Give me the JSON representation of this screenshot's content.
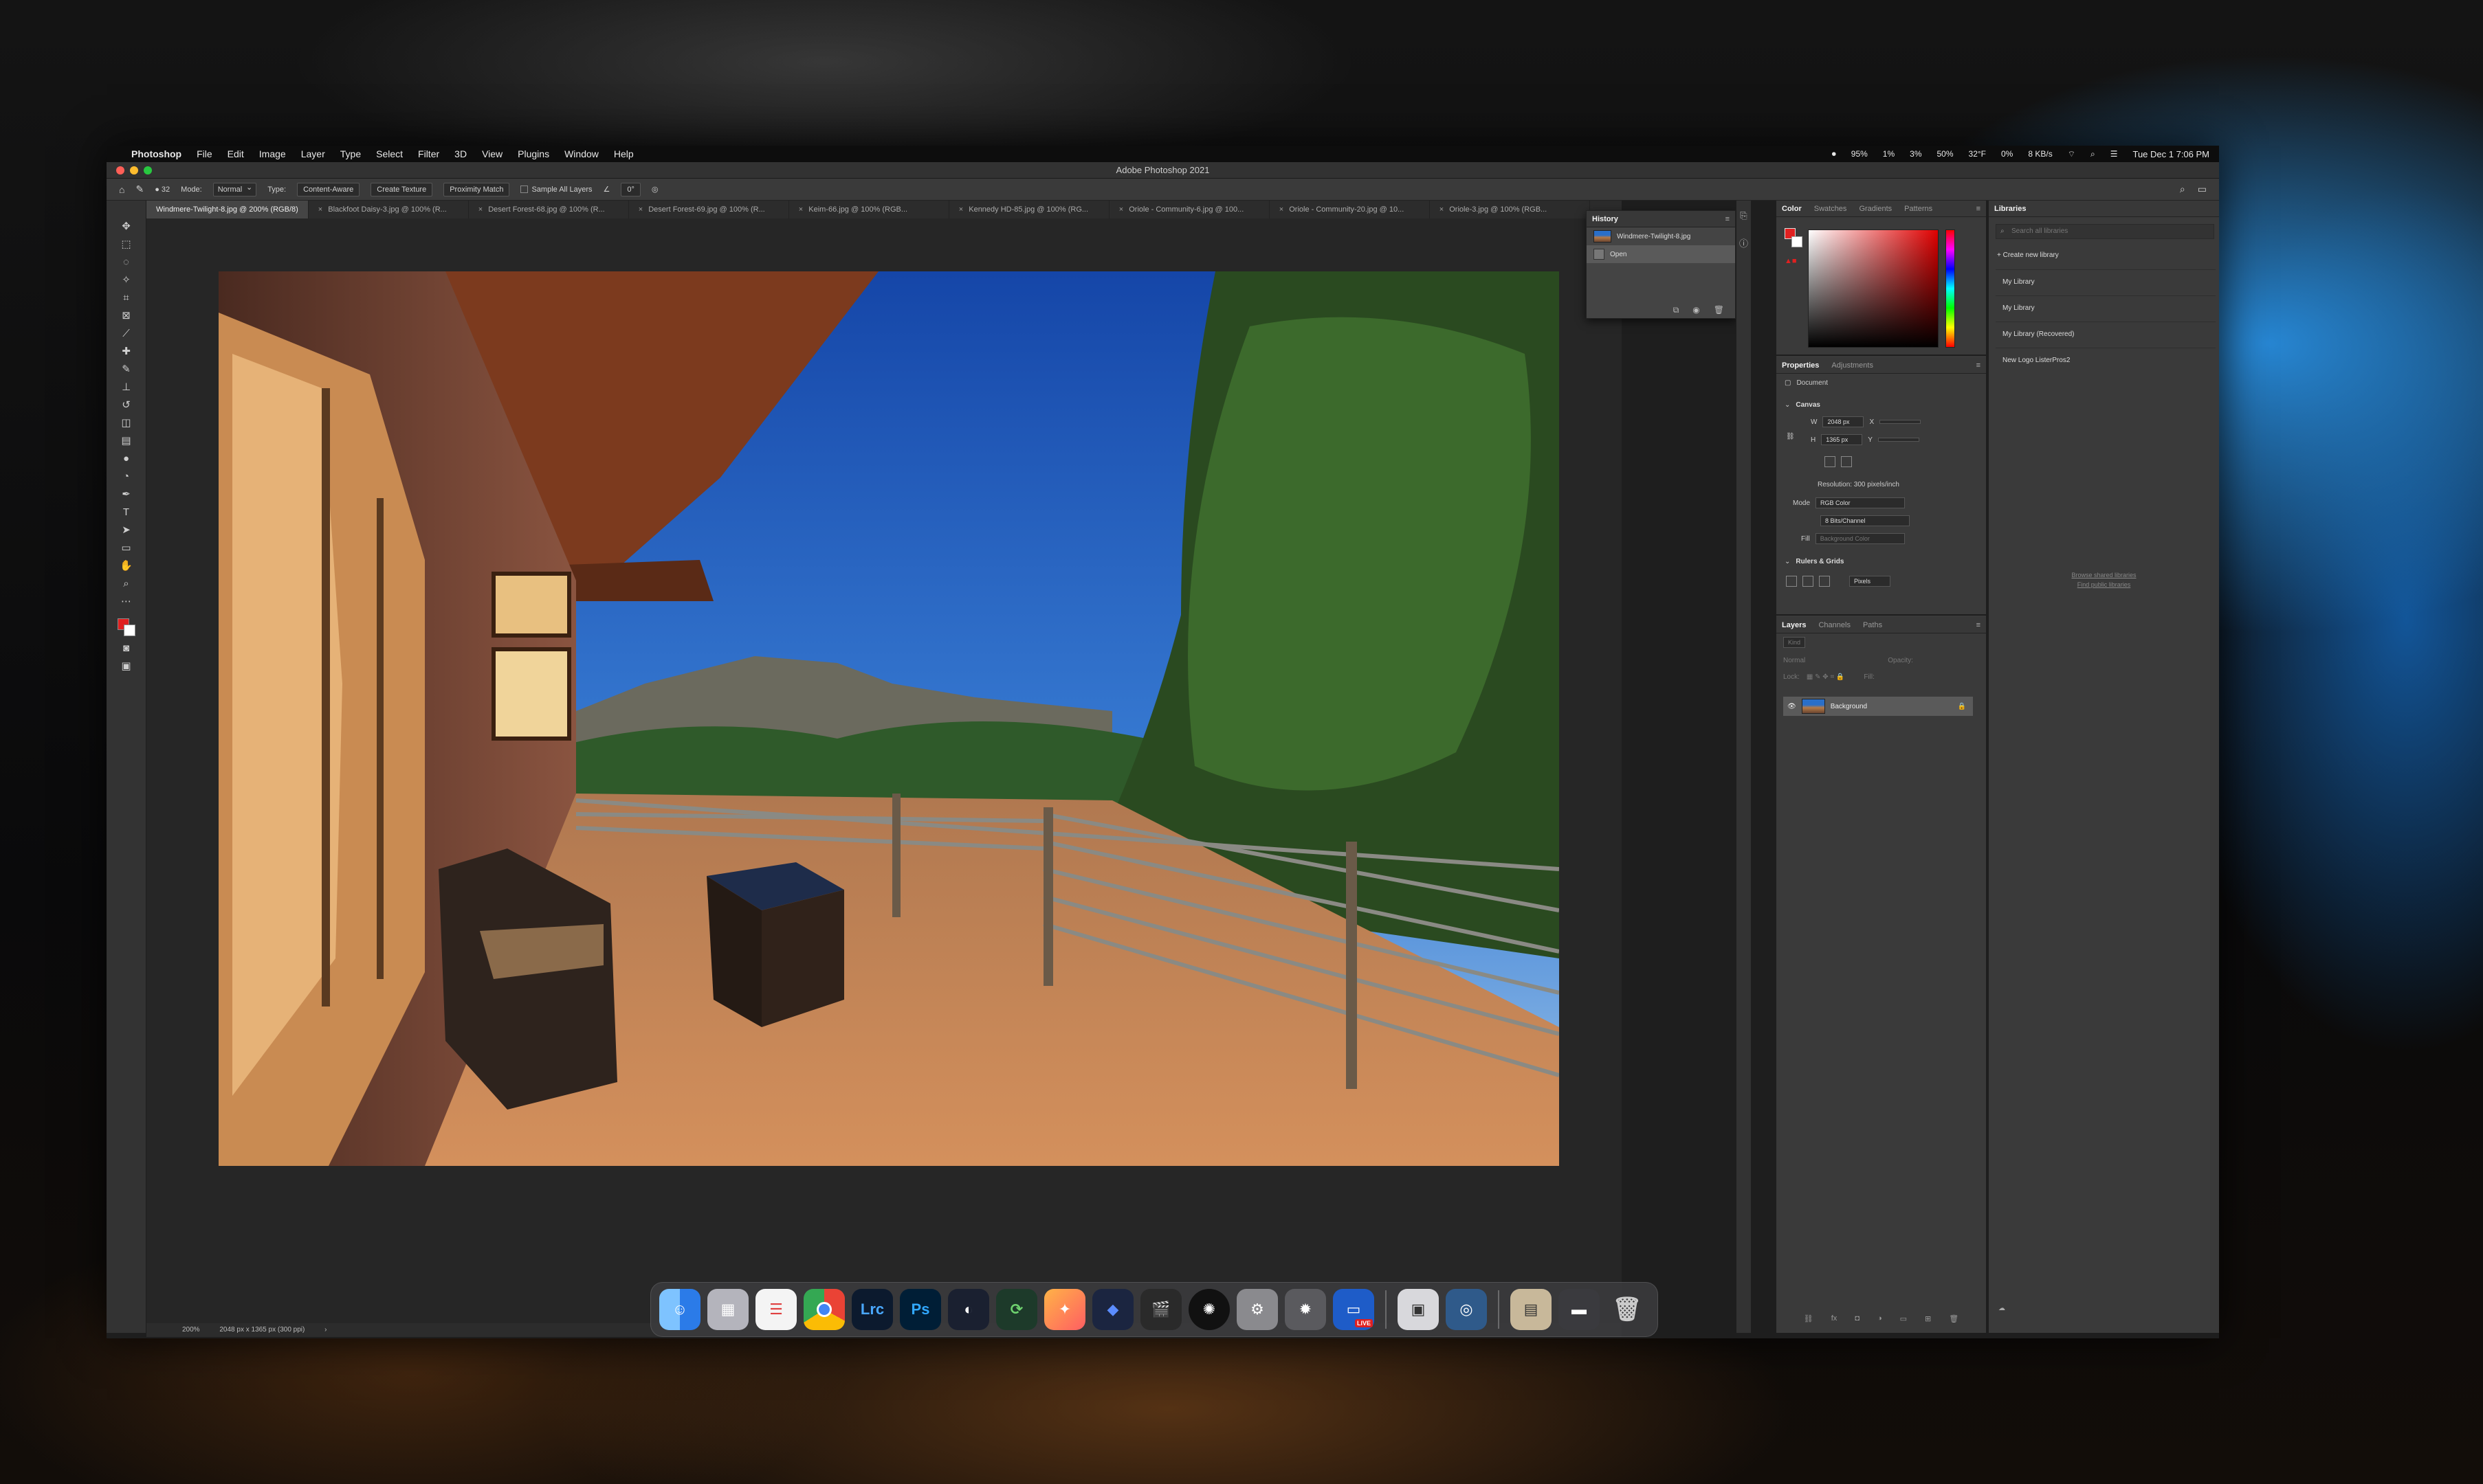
{
  "menubar": {
    "app_name": "Photoshop",
    "items": [
      "File",
      "Edit",
      "Image",
      "Layer",
      "Type",
      "Select",
      "Filter",
      "3D",
      "View",
      "Plugins",
      "Window",
      "Help"
    ],
    "status": [
      "95%",
      "1%",
      "3%",
      "50%",
      "32°F",
      "0%",
      "8 KB/s"
    ],
    "clock": "Tue Dec 1  7:06 PM"
  },
  "titlebar": {
    "title": "Adobe Photoshop 2021"
  },
  "options": {
    "brush_size": "32",
    "mode_label": "Mode:",
    "mode_value": "Normal",
    "type_label": "Type:",
    "type_buttons": [
      "Content-Aware",
      "Create Texture",
      "Proximity Match"
    ],
    "sample_all_layers": "Sample All Layers",
    "angle_value": "0°"
  },
  "tabs": [
    "Windmere-Twilight-8.jpg @ 200% (RGB/8)",
    "Blackfoot Daisy-3.jpg @ 100% (R...",
    "Desert Forest-68.jpg @ 100% (R...",
    "Desert Forest-69.jpg @ 100% (R...",
    "Keim-66.jpg @ 100% (RGB...",
    "Kennedy HD-85.jpg @ 100% (RG...",
    "Oriole - Community-6.jpg @ 100...",
    "Oriole - Community-20.jpg @ 10...",
    "Oriole-3.jpg @ 100% (RGB..."
  ],
  "statusbar": {
    "zoom": "200%",
    "doc_info": "2048 px x 1365 px (300 ppi)"
  },
  "history": {
    "tab": "History",
    "snapshot": "Windmere-Twilight-8.jpg",
    "states": [
      "Open"
    ]
  },
  "color_panel": {
    "tabs": [
      "Color",
      "Swatches",
      "Gradients",
      "Patterns"
    ]
  },
  "properties": {
    "tabs": [
      "Properties",
      "Adjustments"
    ],
    "kind": "Document",
    "canvas_header": "Canvas",
    "w_label": "W",
    "w_value": "2048 px",
    "h_label": "H",
    "h_value": "1365 px",
    "x_label": "X",
    "y_label": "Y",
    "resolution": "Resolution: 300 pixels/inch",
    "mode_label": "Mode",
    "mode_value": "RGB Color",
    "bits_value": "8 Bits/Channel",
    "fill_label": "Fill",
    "fill_value": "Background Color",
    "rulers_header": "Rulers & Grids",
    "units_value": "Pixels"
  },
  "layers": {
    "tabs": [
      "Layers",
      "Channels",
      "Paths"
    ],
    "kind_placeholder": "Kind",
    "blend": "Normal",
    "opacity_label": "Opacity:",
    "lock_label": "Lock:",
    "fill_label": "Fill:",
    "items": [
      "Background"
    ]
  },
  "libraries": {
    "tab": "Libraries",
    "search_placeholder": "Search all libraries",
    "create": "Create new library",
    "items": [
      "My Library",
      "My Library",
      "My Library (Recovered)",
      "New Logo ListerPros2"
    ],
    "links": [
      "Browse shared libraries",
      "Find public libraries"
    ]
  },
  "dock": {
    "apps": [
      "Finder",
      "Launchpad",
      "Reminders",
      "Chrome",
      "Lrc",
      "Ps",
      "Camo",
      "Migration",
      "Pixelmator",
      "Affinity",
      "Final Cut Pro",
      "DaVinci Resolve",
      "System Preferences",
      "Compressor",
      "Ecamm Live",
      "Image Capture",
      "QuickTime",
      "Photos",
      "Scanner",
      "Trash"
    ],
    "lrc_label": "Lrc",
    "ps_label": "Ps",
    "live_label": "LIVE"
  },
  "colors": {
    "foreground": "#e02020",
    "background": "#ffffff",
    "panel": "#3a3a3a",
    "accent_blue": "#2a6fc9"
  }
}
